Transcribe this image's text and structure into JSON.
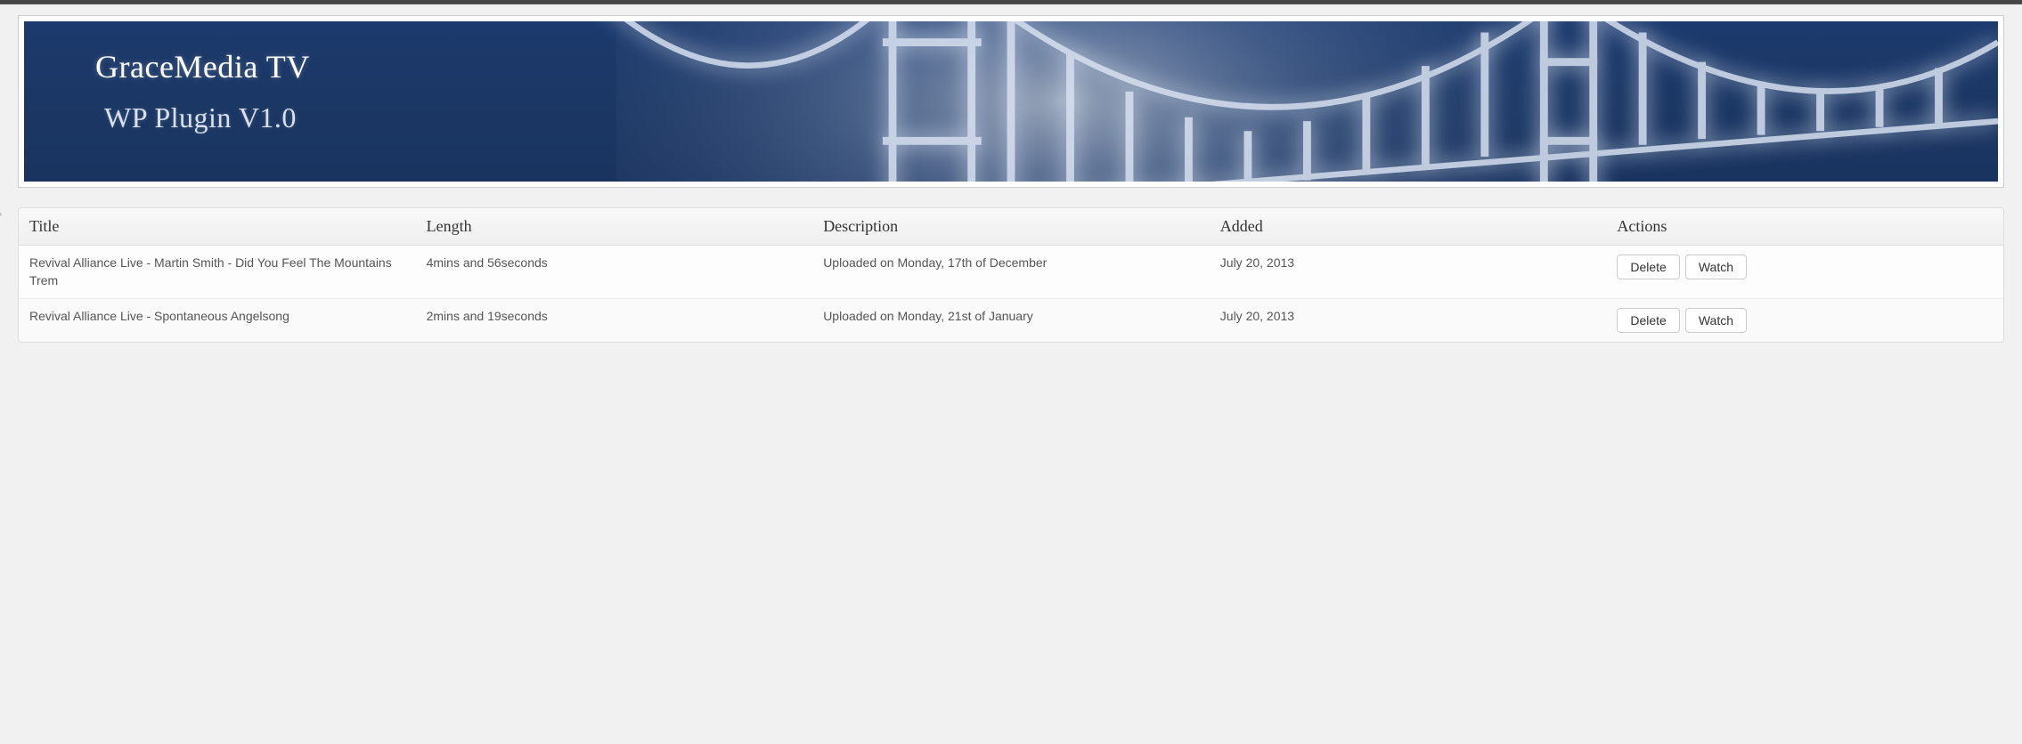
{
  "banner": {
    "title": "GraceMedia TV",
    "subtitle": "WP Plugin V1.0"
  },
  "table": {
    "headers": {
      "title": "Title",
      "length": "Length",
      "description": "Description",
      "added": "Added",
      "actions": "Actions"
    },
    "action_labels": {
      "delete": "Delete",
      "watch": "Watch"
    },
    "rows": [
      {
        "title": "Revival Alliance Live - Martin Smith - Did You Feel The Mountains Trem",
        "length": "4mins and 56seconds",
        "description": "Uploaded on Monday, 17th of December",
        "added": "July 20, 2013"
      },
      {
        "title": "Revival Alliance Live - Spontaneous Angelsong",
        "length": "2mins and 19seconds",
        "description": "Uploaded on Monday, 21st of January",
        "added": "July 20, 2013"
      }
    ]
  }
}
